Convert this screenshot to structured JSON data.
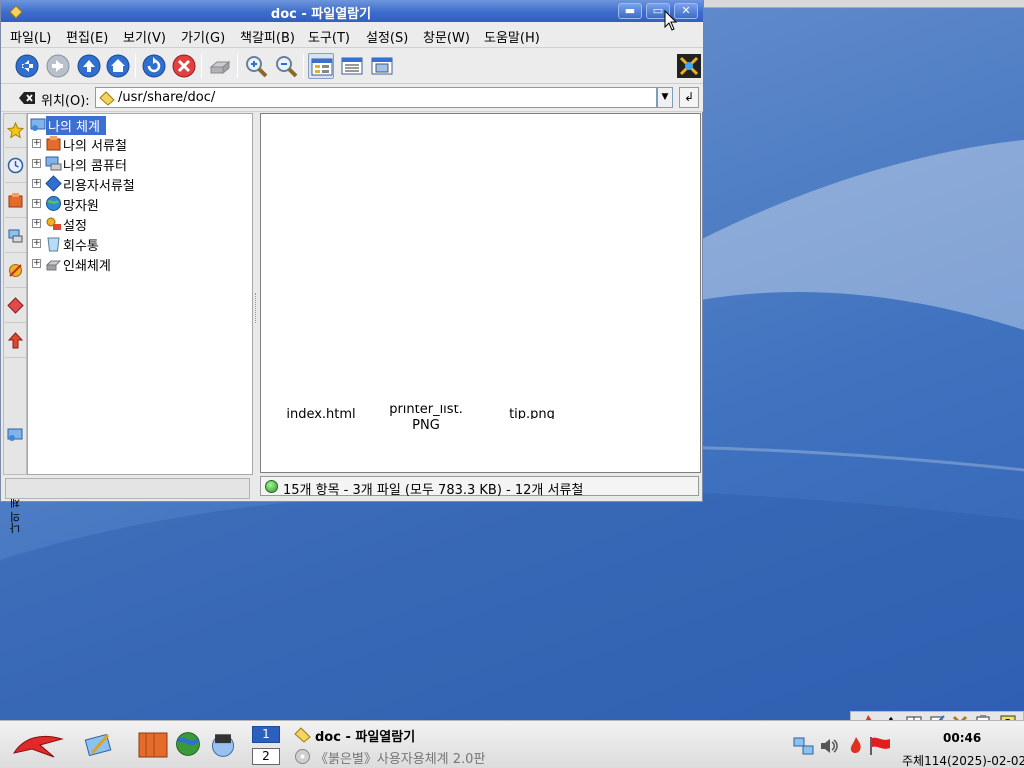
{
  "window": {
    "title": "doc - 파일열람기",
    "title_icon": "folder-icon",
    "controls": {
      "minimize": "▬",
      "maximize": "▭",
      "close": "✕"
    }
  },
  "menu": [
    {
      "label": "파일(L)"
    },
    {
      "label": "편집(E)"
    },
    {
      "label": "보기(V)"
    },
    {
      "label": "가기(G)"
    },
    {
      "label": "책갈피(B)"
    },
    {
      "label": "도구(T)"
    },
    {
      "label": "설정(S)"
    },
    {
      "label": "창문(W)"
    },
    {
      "label": "도움말(H)"
    }
  ],
  "toolbar": {
    "icons": [
      "back-icon",
      "forward-icon",
      "up-icon",
      "home-icon",
      "reload-icon",
      "stop-icon",
      "print-icon",
      "zoom-in-icon",
      "zoom-out-icon",
      "icon-view-icon",
      "detail-view-icon",
      "preview-icon",
      "throbber-icon"
    ]
  },
  "location": {
    "label": "위치(O):",
    "value": "/usr/share/doc/"
  },
  "sidebar": {
    "tabs": [
      "bookmark-star-icon",
      "history-icon",
      "home-folder-icon",
      "network-icon",
      "services-icon",
      "tag-icon",
      "arrow-icon",
      "my-system-icon"
    ],
    "vertical_label": "나의 체계"
  },
  "tree": {
    "root": "나의 체계",
    "items": [
      {
        "label": "나의 서류철",
        "icon": "documents-icon"
      },
      {
        "label": "나의 콤퓨터",
        "icon": "computer-icon"
      },
      {
        "label": "리용자서류철",
        "icon": "user-folder-icon"
      },
      {
        "label": "망자원",
        "icon": "network-globe-icon"
      },
      {
        "label": "설정",
        "icon": "settings-icon"
      },
      {
        "label": "회수통",
        "icon": "trash-icon"
      },
      {
        "label": "인쇄체계",
        "icon": "printer-icon"
      }
    ]
  },
  "files": [
    {
      "line1": "index.html",
      "line2": ""
    },
    {
      "line1": "printer_list.",
      "line2": "PNG"
    },
    {
      "line1": "tip.png",
      "line2": ""
    }
  ],
  "status": {
    "text": "15개 항목 - 3개 파일 (모두 783.3 KB) - 12개 서류철"
  },
  "taskbar": {
    "desktops": [
      "1",
      "2"
    ],
    "tasks": [
      {
        "label": "doc - 파일열람기",
        "icon": "folder-icon",
        "active": true
      },
      {
        "label": "《붉은별》사용자용체계 2.0판",
        "icon": "disc-icon",
        "active": false
      }
    ],
    "clock": "00:46",
    "date": "주체114(2025)-02-02"
  },
  "colors": {
    "titlebar": "#3d6ccc",
    "selection": "#3b6fd1",
    "desktop": "#4a78c4"
  }
}
